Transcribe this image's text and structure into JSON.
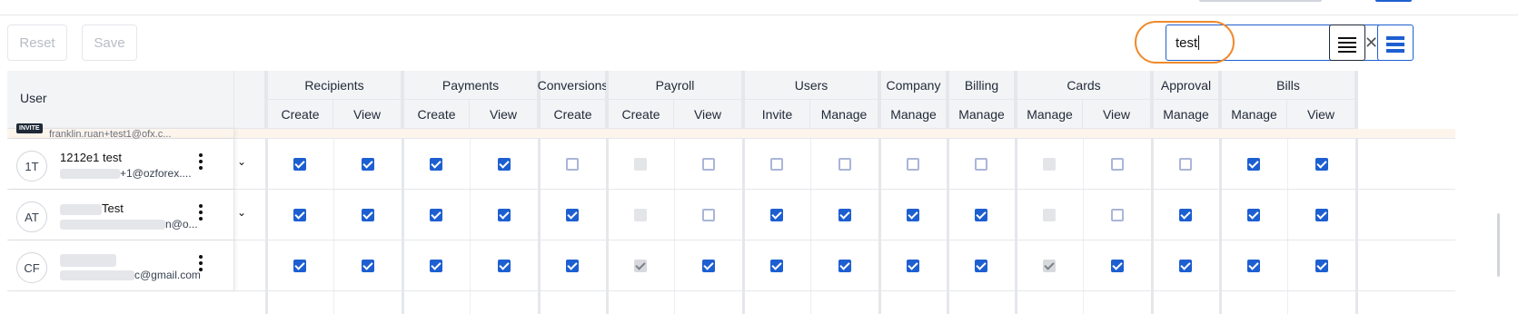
{
  "toolbar": {
    "reset_label": "Reset",
    "save_label": "Save"
  },
  "search": {
    "value": "test",
    "clear_icon": "close-icon",
    "search_icon": "search-icon"
  },
  "view_toggle": [
    {
      "name": "compact-view-icon",
      "active": false
    },
    {
      "name": "comfortable-view-icon",
      "active": true
    }
  ],
  "colors": {
    "accent": "#1d5fd1",
    "highlight": "#f0892c",
    "invite_row": "#fdf4ec"
  },
  "table": {
    "user_header": "User",
    "groups": [
      {
        "label": "Recipients",
        "cols": [
          "Create",
          "View"
        ]
      },
      {
        "label": "Payments",
        "cols": [
          "Create",
          "View"
        ]
      },
      {
        "label": "Conversions",
        "cols": [
          "Create"
        ]
      },
      {
        "label": "Payroll",
        "cols": [
          "Create",
          "View"
        ]
      },
      {
        "label": "Users",
        "cols": [
          "Invite",
          "Manage"
        ]
      },
      {
        "label": "Company",
        "cols": [
          "Manage"
        ]
      },
      {
        "label": "Billing",
        "cols": [
          "Manage"
        ]
      },
      {
        "label": "Cards",
        "cols": [
          "Manage",
          "View"
        ]
      },
      {
        "label": "Approval",
        "cols": [
          "Manage"
        ]
      },
      {
        "label": "Bills",
        "cols": [
          "Manage",
          "View"
        ]
      }
    ],
    "invite_row": {
      "badge": "INVITE",
      "email": "franklin.ruan+test1@ofx.c..."
    },
    "rows": [
      {
        "initials": "1T",
        "name": "1212e1 test",
        "email": "+1@ozforex....",
        "expandable": true,
        "perms": [
          "on",
          "on",
          "on",
          "on",
          "off",
          "na",
          "off",
          "off",
          "off",
          "off",
          "off",
          "na",
          "off",
          "off",
          "on",
          "on"
        ]
      },
      {
        "initials": "AT",
        "name": "Test",
        "email": "n@o...",
        "expandable": true,
        "perms": [
          "on",
          "on",
          "on",
          "on",
          "on",
          "na",
          "off",
          "on",
          "on",
          "on",
          "on",
          "na",
          "off",
          "on",
          "on",
          "on"
        ]
      },
      {
        "initials": "CF",
        "name": "",
        "email": "c@gmail.com",
        "expandable": false,
        "perms": [
          "on",
          "on",
          "on",
          "on",
          "on",
          "dis",
          "on",
          "on",
          "on",
          "on",
          "on",
          "dis",
          "on",
          "on",
          "on",
          "on"
        ]
      }
    ]
  }
}
